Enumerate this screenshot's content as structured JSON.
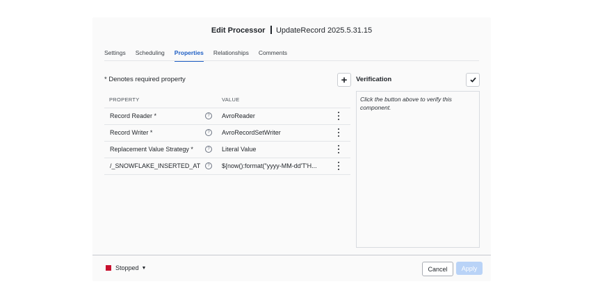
{
  "dialog": {
    "title": "Edit Processor",
    "subtitle": "UpdateRecord 2025.5.31.15"
  },
  "tabs": [
    {
      "label": "Settings",
      "active": false
    },
    {
      "label": "Scheduling",
      "active": false
    },
    {
      "label": "Properties",
      "active": true
    },
    {
      "label": "Relationships",
      "active": false
    },
    {
      "label": "Comments",
      "active": false
    }
  ],
  "properties": {
    "required_note": "* Denotes required property",
    "add_icon": "plus-icon",
    "columns": {
      "property": "PROPERTY",
      "value": "VALUE"
    },
    "rows": [
      {
        "name": "Record Reader *",
        "value": "AvroReader"
      },
      {
        "name": "Record Writer *",
        "value": "AvroRecordSetWriter"
      },
      {
        "name": "Replacement Value Strategy *",
        "value": "Literal Value"
      },
      {
        "name": "/_SNOWFLAKE_INSERTED_AT",
        "value": "${now():format(\"yyyy-MM-dd'T'H..."
      }
    ]
  },
  "verification": {
    "label": "Verification",
    "button_icon": "checkmark-icon",
    "message": "Click the button above to verify this component."
  },
  "footer": {
    "status": "Stopped",
    "status_color": "#c8102e",
    "cancel_label": "Cancel",
    "apply_label": "Apply"
  }
}
